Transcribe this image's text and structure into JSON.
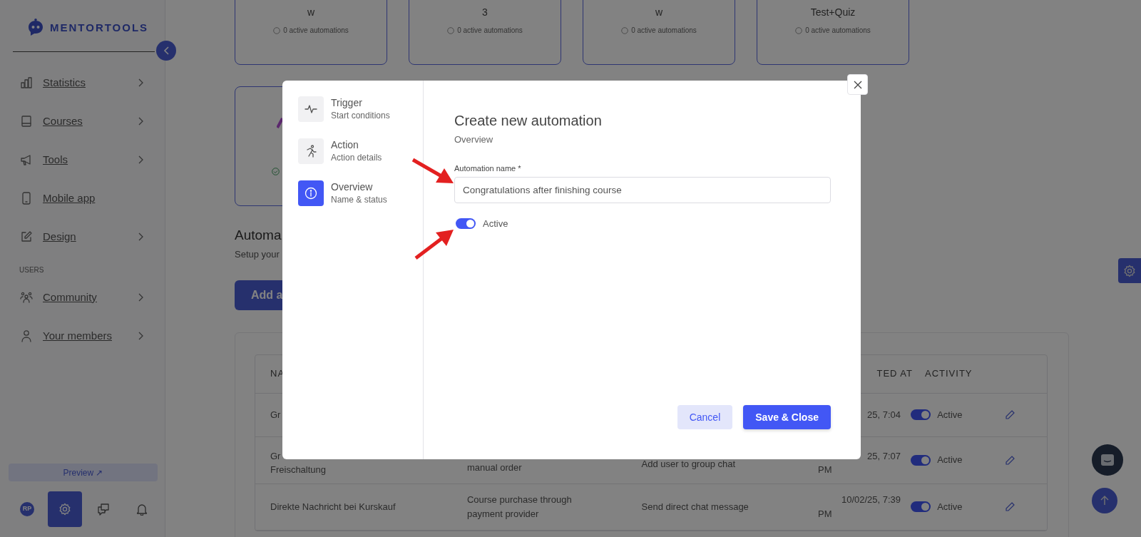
{
  "sidebar": {
    "brand": "MENTORTOOLS",
    "nav": [
      {
        "kind": "item",
        "label": "Statistics",
        "expandable": true
      },
      {
        "kind": "item",
        "label": "Courses",
        "expandable": true
      },
      {
        "kind": "item",
        "label": "Tools",
        "expandable": true
      },
      {
        "kind": "item",
        "label": "Mobile app",
        "expandable": false
      },
      {
        "kind": "item",
        "label": "Design",
        "expandable": true
      },
      {
        "kind": "section",
        "label": "USERS"
      },
      {
        "kind": "item",
        "label": "Community",
        "expandable": true
      },
      {
        "kind": "item",
        "label": "Your members",
        "expandable": true
      }
    ],
    "preview_button": "Preview ↗",
    "avatar": "RP",
    "bottom_tabs": [
      {
        "kind": "settings",
        "selected": true
      },
      {
        "kind": "chat",
        "selected": false
      },
      {
        "kind": "bell",
        "selected": false
      }
    ]
  },
  "course_cards": [
    {
      "title": "w",
      "status": "0 active automations"
    },
    {
      "title": "3",
      "status": "0 active automations"
    },
    {
      "title": "w",
      "status": "0 active automations"
    },
    {
      "title": "Test+Quiz",
      "status": "0 active automations"
    }
  ],
  "page": {
    "heading": "Automa",
    "subheading": "Setup your",
    "add_button": "Add a"
  },
  "table": {
    "header": {
      "name": "NA",
      "created": "TED AT",
      "activity": "ACTIVITY"
    },
    "rows": [
      {
        "name": "Gr",
        "created": "25, 7:04",
        "active": true,
        "activity": "Active"
      },
      {
        "name": "Gr",
        "name_line_2": "Freischaltung",
        "trigger": "manual order",
        "action": "Add user to group chat",
        "created": "25, 7:07",
        "created_line_2": "PM",
        "active": true,
        "activity": "Active"
      },
      {
        "name": "Direkte Nachricht bei Kurskauf",
        "trigger": "Course purchase through payment provider",
        "action": "Send direct chat message",
        "created": "10/02/25, 7:39",
        "created_line_2": "PM",
        "active": true,
        "activity": "Active"
      }
    ]
  },
  "modal": {
    "steps": [
      {
        "kind": "pulse",
        "title": "Trigger",
        "subtitle": "Start conditions",
        "selected": false
      },
      {
        "kind": "runner",
        "title": "Action",
        "subtitle": "Action details",
        "selected": false
      },
      {
        "kind": "info",
        "title": "Overview",
        "subtitle": "Name & status",
        "selected": true
      }
    ],
    "title": "Create new automation",
    "subtitle": "Overview",
    "field": {
      "label": "Automation name *",
      "value": "Congratulations after finishing course"
    },
    "toggle": {
      "label": "Active",
      "on": true
    },
    "buttons": [
      {
        "kind": "secondary",
        "label": "Cancel"
      },
      {
        "kind": "primary",
        "label": "Save & Close"
      }
    ]
  }
}
